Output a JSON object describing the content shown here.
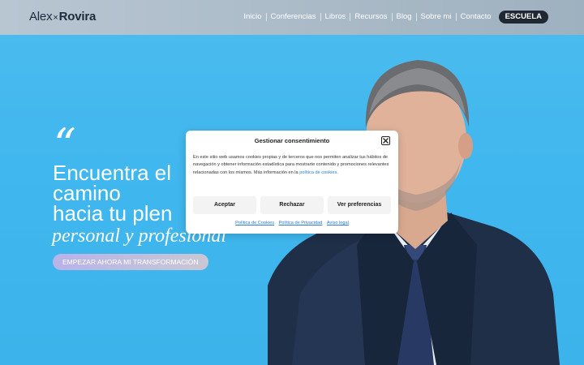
{
  "header": {
    "logo_first": "Alex",
    "logo_sep": "×",
    "logo_last": "Rovira",
    "nav": [
      "Inicio",
      "Conferencias",
      "Libros",
      "Recursos",
      "Blog",
      "Sobre mi",
      "Contacto"
    ],
    "escuela_label": "ESCUELA"
  },
  "hero": {
    "quote_mark": "“",
    "headline_lines": [
      "Encuentra el",
      "camino",
      "hacia tu plen"
    ],
    "subhead": "personal y profesional",
    "cta_label": "EMPEZAR AHORA MI TRANSFORMACIÓN"
  },
  "consent": {
    "title": "Gestionar consentimiento",
    "body": "En este sitio web usamos cookies propias y de terceros que nos permiten analizar tus hábitos de navegación y obtener información estadística para mostrarte contenido y promociones relevantes relacionadas con los mismos. Más información en la",
    "body_link": "política de cookies",
    "body_end": ".",
    "accept_label": "Aceptar",
    "reject_label": "Rechazar",
    "prefs_label": "Ver preferencias",
    "links": [
      "Política de Cookies",
      "Política de Privacidad",
      "Aviso legal"
    ]
  },
  "colors": {
    "background": "#40b7ee",
    "header": "#aebdca",
    "escuela_bg": "#1f2833",
    "link": "#2b7bd1"
  }
}
